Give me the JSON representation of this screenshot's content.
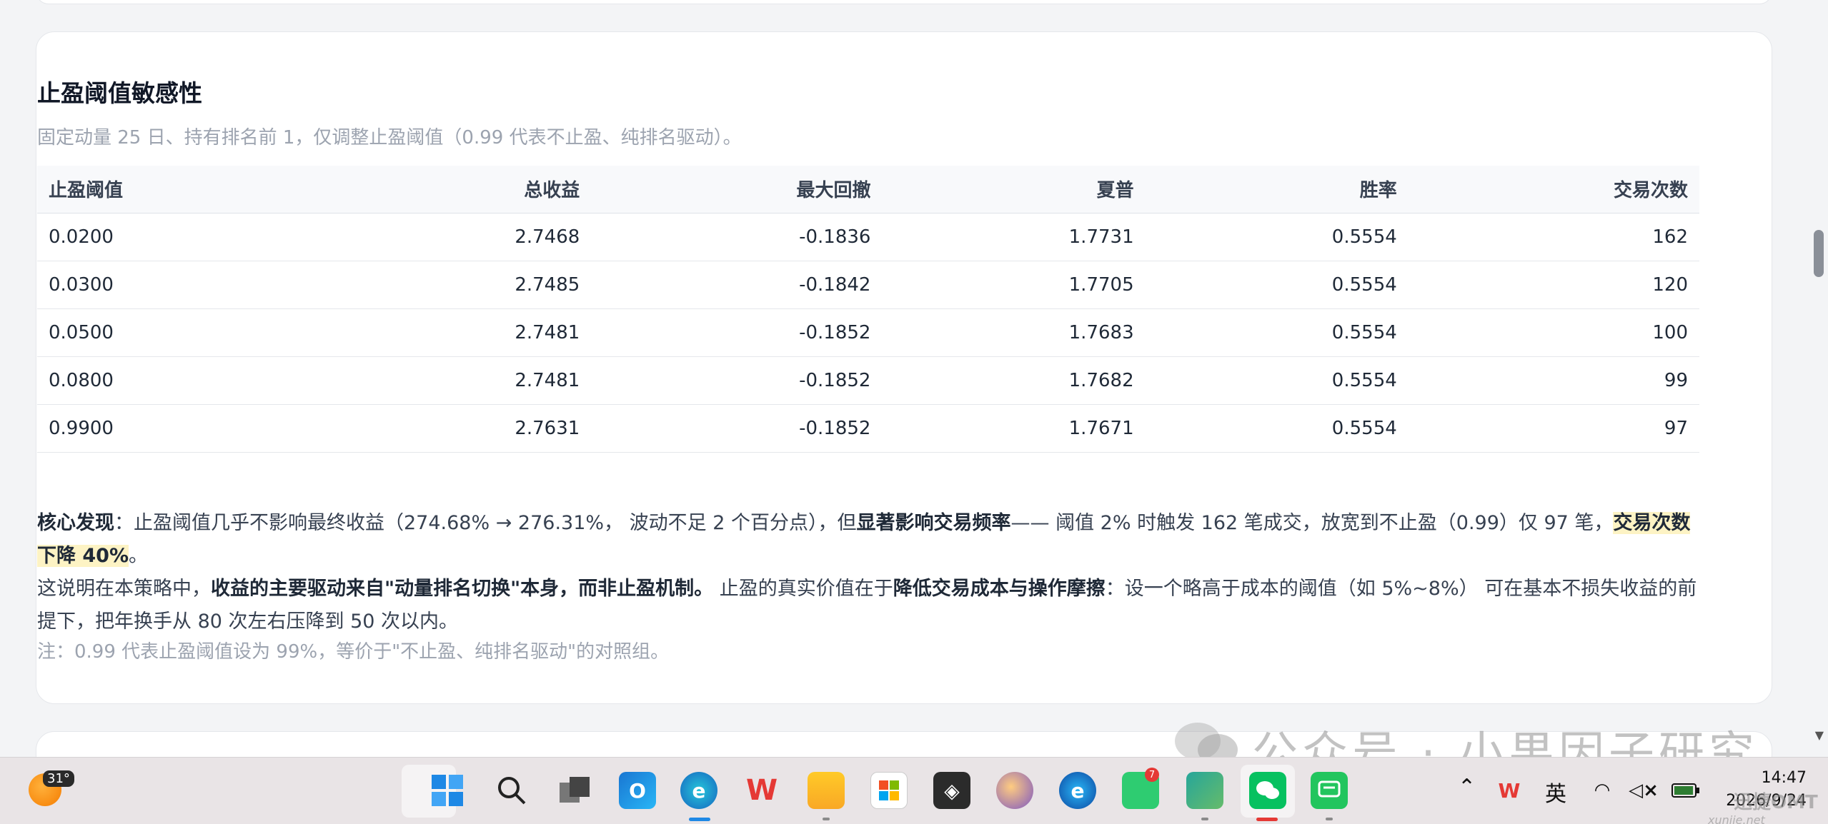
{
  "section": {
    "title": "止盈阈值敏感性",
    "subtitle": "固定动量 25 日、持有排名前 1，仅调整止盈阈值（0.99 代表不止盈、纯排名驱动）。"
  },
  "table": {
    "headers": [
      "止盈阈值",
      "总收益",
      "最大回撤",
      "夏普",
      "胜率",
      "交易次数"
    ],
    "rows": [
      [
        "0.0200",
        "2.7468",
        "-0.1836",
        "1.7731",
        "0.5554",
        "162"
      ],
      [
        "0.0300",
        "2.7485",
        "-0.1842",
        "1.7705",
        "0.5554",
        "120"
      ],
      [
        "0.0500",
        "2.7481",
        "-0.1852",
        "1.7683",
        "0.5554",
        "100"
      ],
      [
        "0.0800",
        "2.7481",
        "-0.1852",
        "1.7682",
        "0.5554",
        "99"
      ],
      [
        "0.9900",
        "2.7631",
        "-0.1852",
        "1.7671",
        "0.5554",
        "97"
      ]
    ]
  },
  "finding": {
    "label": "核心发现",
    "p1_a": "：止盈阈值几乎不影响最终收益（274.68% → 276.31%， 波动不足 2 个百分点），但",
    "p1_b": "显著影响交易频率",
    "p1_c": "—— 阈值 2% 时触发 162 笔成交，放宽到不止盈（0.99）仅 97 笔，",
    "p1_hl": "交易次数下降 40%",
    "p1_d": "。",
    "p2_a": "这说明在本策略中，",
    "p2_b": "收益的主要驱动来自\"动量排名切换\"本身，而非止盈机制。",
    "p2_c": " 止盈的真实价值在于",
    "p2_d": "降低交易成本与操作摩擦",
    "p2_e": "：设一个略高于成本的阈值（如 5%~8%） 可在基本不损失收益的前提下，把年换手从 80 次左右压降到 50 次以内。",
    "note": "注：0.99 代表止盈阈值设为 99%，等价于\"不止盈、纯排名驱动\"的对照组。"
  },
  "watermark": {
    "text": "公众号 · 小果因子研究",
    "brand": "迅捷OMT",
    "brand_sub": "xunjie.net"
  },
  "taskbar": {
    "temperature": "31°",
    "badge_count": "7",
    "ime": "英",
    "time": "14:47",
    "date": "2026/9/24",
    "icons": [
      "start-icon",
      "search-icon",
      "task-view-icon",
      "outlook-icon",
      "edge-icon",
      "wps-icon",
      "file-explorer-icon",
      "store-icon",
      "unity-icon",
      "paint-icon",
      "edge-ai-icon",
      "bookmark-app-icon",
      "app-store-icon",
      "wechat-icon",
      "messages-icon"
    ]
  }
}
